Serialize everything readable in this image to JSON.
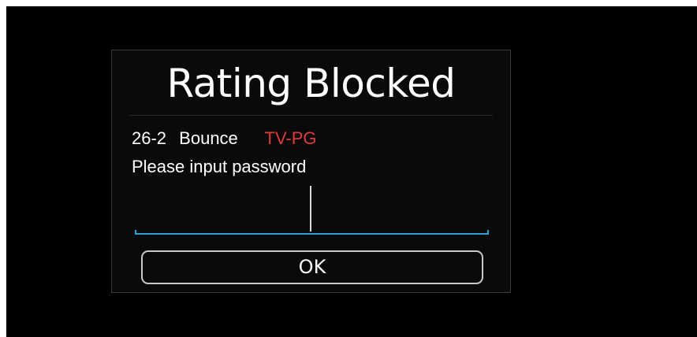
{
  "dialog": {
    "title": "Rating Blocked",
    "channel_number": "26-2",
    "channel_name": "Bounce",
    "rating": "TV-PG",
    "prompt": "Please input password",
    "password_value": "",
    "ok_label": "OK"
  },
  "colors": {
    "background": "#000000",
    "text": "#ffffff",
    "rating": "#e03a3a",
    "input_underline": "#29a3d9",
    "button_border": "#c8c8c8"
  }
}
